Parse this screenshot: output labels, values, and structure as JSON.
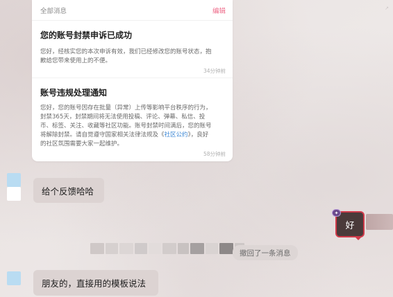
{
  "notifications": {
    "header_title": "全部消息",
    "edit_label": "编辑",
    "messages": [
      {
        "title": "您的账号封禁申诉已成功",
        "body": "您好，经核实您的本次申诉有效，我们已经修改您的账号状态，抱\n歉给您带来使用上的不便。",
        "time": "34分钟前"
      },
      {
        "title": "账号违规处理通知",
        "body_part1": "您好，您的账号因存在批量（异常）上传等影响平台秩序的行为，\n封禁365天，封禁期间将无法使用投稿、评论、弹幕、私信、投\n币、标签、关注、收藏等社区功能。账号封禁时间满后，您的账号\n将解除封禁。请自觉遵守国家相关法律法规及《",
        "link_text": "社区公约",
        "body_part2": "》，良好\n的社区氛围需要大家一起维护。",
        "time": "58分钟前"
      }
    ]
  },
  "chat": {
    "message_1": "给个反馈哈哈",
    "reply_right": "好",
    "recall_notice": "撤回了一条消息",
    "message_2": "朋友的，直接用的模板说法"
  },
  "colors": {
    "accent_pink": "#ee6b8a",
    "link_blue": "#3a86d4",
    "bubble_border": "#d13a4a"
  }
}
